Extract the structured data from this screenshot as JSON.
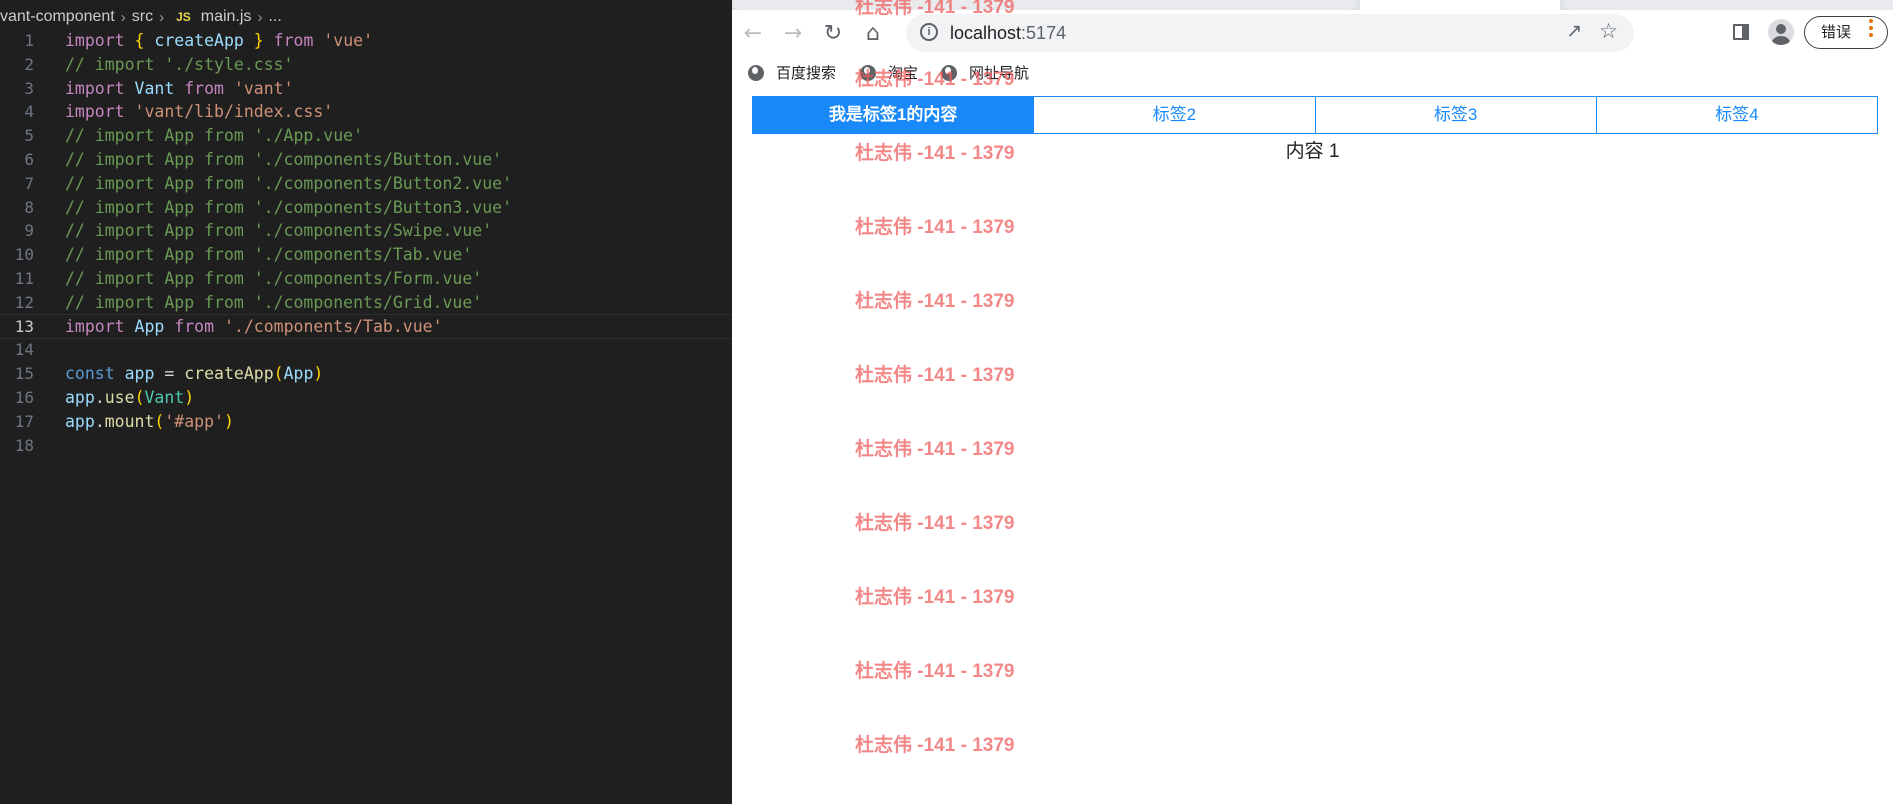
{
  "editor": {
    "breadcrumb": {
      "project": "vant-component",
      "folder": "src",
      "file_badge": "JS",
      "file": "main.js",
      "more": "..."
    },
    "lines": [
      {
        "n": "1",
        "tokens": [
          [
            "kw",
            "import"
          ],
          [
            "op",
            " "
          ],
          [
            "br1",
            "{"
          ],
          [
            "op",
            " "
          ],
          [
            "id",
            "createApp"
          ],
          [
            "op",
            " "
          ],
          [
            "br1",
            "}"
          ],
          [
            "op",
            " "
          ],
          [
            "kw",
            "from"
          ],
          [
            "op",
            " "
          ],
          [
            "str",
            "'vue'"
          ]
        ]
      },
      {
        "n": "2",
        "tokens": [
          [
            "cm",
            "// import './style.css'"
          ]
        ]
      },
      {
        "n": "3",
        "tokens": [
          [
            "kw",
            "import"
          ],
          [
            "op",
            " "
          ],
          [
            "id",
            "Vant"
          ],
          [
            "op",
            " "
          ],
          [
            "kw",
            "from"
          ],
          [
            "op",
            " "
          ],
          [
            "str",
            "'vant'"
          ]
        ]
      },
      {
        "n": "4",
        "tokens": [
          [
            "kw",
            "import"
          ],
          [
            "op",
            " "
          ],
          [
            "str",
            "'vant/lib/index.css'"
          ]
        ]
      },
      {
        "n": "5",
        "tokens": [
          [
            "cm",
            "// import App from './App.vue'"
          ]
        ]
      },
      {
        "n": "6",
        "tokens": [
          [
            "cm",
            "// import App from './components/Button.vue'"
          ]
        ]
      },
      {
        "n": "7",
        "tokens": [
          [
            "cm",
            "// import App from './components/Button2.vue'"
          ]
        ]
      },
      {
        "n": "8",
        "tokens": [
          [
            "cm",
            "// import App from './components/Button3.vue'"
          ]
        ]
      },
      {
        "n": "9",
        "tokens": [
          [
            "cm",
            "// import App from './components/Swipe.vue'"
          ]
        ]
      },
      {
        "n": "10",
        "tokens": [
          [
            "cm",
            "// import App from './components/Tab.vue'"
          ]
        ]
      },
      {
        "n": "11",
        "tokens": [
          [
            "cm",
            "// import App from './components/Form.vue'"
          ]
        ]
      },
      {
        "n": "12",
        "tokens": [
          [
            "cm",
            "// import App from './components/Grid.vue'"
          ]
        ]
      },
      {
        "n": "13",
        "active": true,
        "tokens": [
          [
            "kw",
            "import"
          ],
          [
            "op",
            " "
          ],
          [
            "id",
            "App"
          ],
          [
            "op",
            " "
          ],
          [
            "kw",
            "from"
          ],
          [
            "op",
            " "
          ],
          [
            "str",
            "'./components/Tab.vue'"
          ]
        ]
      },
      {
        "n": "14",
        "tokens": []
      },
      {
        "n": "15",
        "tokens": [
          [
            "kw2",
            "const"
          ],
          [
            "op",
            " "
          ],
          [
            "id",
            "app"
          ],
          [
            "op",
            " = "
          ],
          [
            "fn",
            "createApp"
          ],
          [
            "br1",
            "("
          ],
          [
            "id",
            "App"
          ],
          [
            "br1",
            ")"
          ]
        ]
      },
      {
        "n": "16",
        "tokens": [
          [
            "id",
            "app"
          ],
          [
            "op",
            "."
          ],
          [
            "fn",
            "use"
          ],
          [
            "br1",
            "("
          ],
          [
            "cls",
            "Vant"
          ],
          [
            "br1",
            ")"
          ]
        ]
      },
      {
        "n": "17",
        "tokens": [
          [
            "id",
            "app"
          ],
          [
            "op",
            "."
          ],
          [
            "fn",
            "mount"
          ],
          [
            "br1",
            "("
          ],
          [
            "str",
            "'#app'"
          ],
          [
            "br1",
            ")"
          ]
        ]
      },
      {
        "n": "18",
        "tokens": []
      }
    ]
  },
  "browser": {
    "toolbar": {
      "back_icon": "arrow-left-icon",
      "forward_icon": "arrow-right-icon",
      "reload_icon": "reload-icon",
      "home_icon": "home-icon",
      "url_host": "localhost",
      "url_port": ":5174",
      "error_label": "错误"
    },
    "bookmarks": [
      "百度搜索",
      "淘宝",
      "网址导航"
    ],
    "tabs": [
      "我是标签1的内容",
      "标签2",
      "标签3",
      "标签4"
    ],
    "active_tab": 0,
    "content": "内容 1",
    "watermark": "杜志伟 -141 - 1379",
    "colors": {
      "tab_accent": "#1989fa",
      "watermark": "#ee5a5a",
      "editor_bg": "#1f1f1f"
    }
  }
}
